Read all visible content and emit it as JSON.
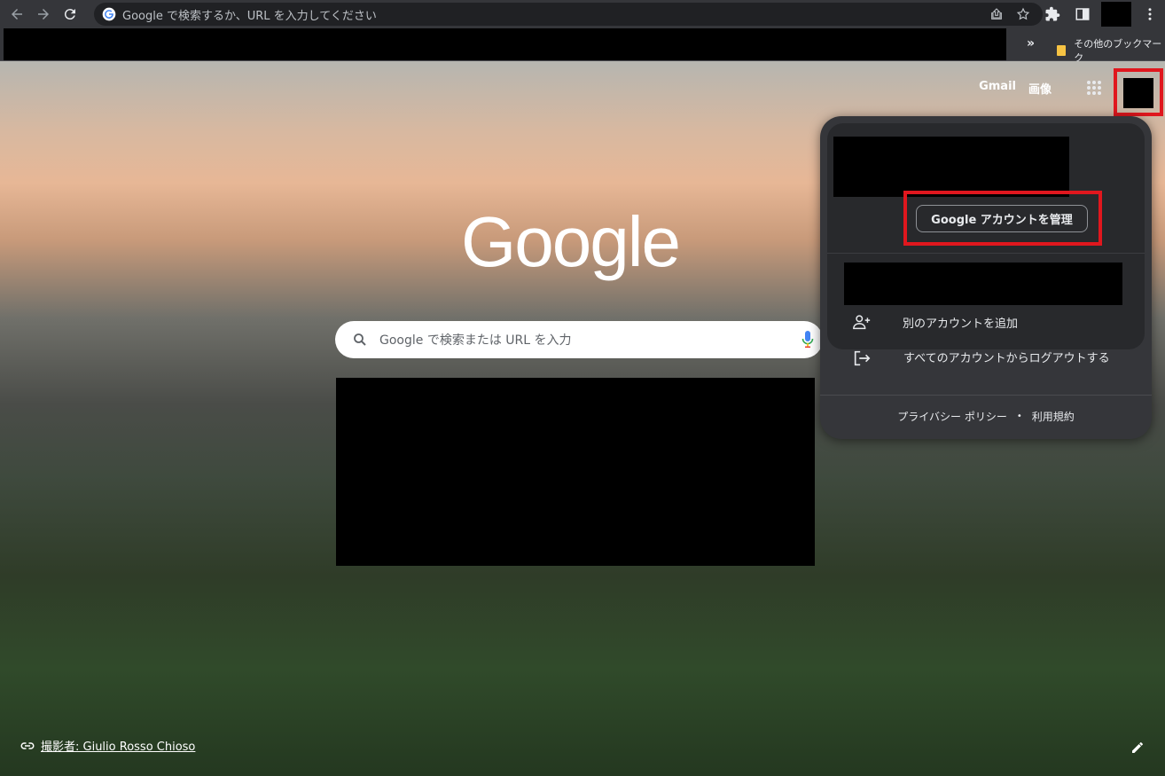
{
  "toolbar": {
    "omnibox_text": "Google で検索するか、URL を入力してください"
  },
  "bookmarks": {
    "overflow": "»",
    "other_bookmarks": "その他のブックマーク"
  },
  "ntp": {
    "top_links": [
      "Gmail",
      "画像"
    ],
    "logo": "Google",
    "search_placeholder": "Google で検索または URL を入力",
    "attribution": "撮影者: Giulio Rosso Chioso"
  },
  "account_popup": {
    "manage_button": "Google アカウントを管理",
    "add_account": "別のアカウントを追加",
    "sign_out_all": "すべてのアカウントからログアウトする",
    "privacy_policy": "プライバシー ポリシー",
    "separator": "•",
    "terms": "利用規約"
  },
  "icons": [
    "back-icon",
    "forward-icon",
    "reload-icon",
    "google-g-icon",
    "share-icon",
    "star-icon",
    "extensions-icon",
    "side-panel-icon",
    "menu-icon",
    "folder-icon",
    "apps-icon",
    "search-icon",
    "mic-icon",
    "link-icon",
    "pencil-icon",
    "add-person-icon",
    "logout-icon"
  ],
  "colors": {
    "highlight": "#e0171e",
    "popup_bg": "#35363a",
    "toolbar_bg": "#35363a"
  }
}
